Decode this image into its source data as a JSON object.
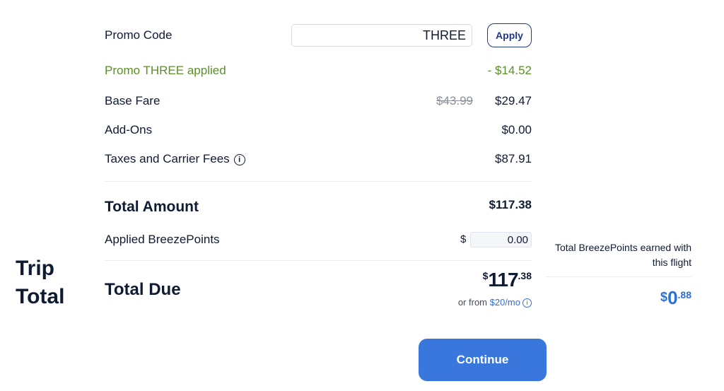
{
  "promo": {
    "label": "Promo Code",
    "value": "THREE",
    "apply_label": "Apply",
    "applied_text": "Promo THREE applied",
    "discount": "- $14.52"
  },
  "summary": {
    "base_fare_label": "Base Fare",
    "base_fare_original": "$43.99",
    "base_fare": "$29.47",
    "addons_label": "Add-Ons",
    "addons": "$0.00",
    "taxes_label": "Taxes and Carrier Fees",
    "taxes": "$87.91",
    "info_glyph": "i"
  },
  "total": {
    "label": "Total Amount",
    "value": "$117.38"
  },
  "breezepoints": {
    "label": "Applied BreezePoints",
    "currency": "$",
    "value": "0.00"
  },
  "trip_total": {
    "heading_line1": "Trip",
    "heading_line2": "Total",
    "due_label": "Total Due",
    "due_symbol": "$",
    "due_main": "117",
    "due_cents": ".38",
    "financing_prefix": "or from",
    "financing_amount": "$20/mo"
  },
  "earned": {
    "text": "Total BreezePoints earned with this flight",
    "symbol": "$",
    "main": "0",
    "cents": ".88"
  },
  "continue_label": "Continue",
  "colors": {
    "navy": "#0f1a33",
    "green": "#5a8f2a",
    "blue": "#2f6fd6",
    "button": "#3a77dc"
  }
}
